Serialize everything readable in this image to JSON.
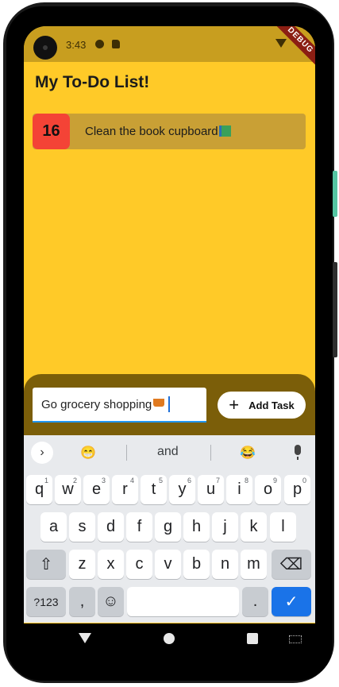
{
  "status_bar": {
    "time": "3:43",
    "debug_label": "DEBUG"
  },
  "app": {
    "title": "My To-Do List!"
  },
  "tasks": [
    {
      "number": "16",
      "text": "Clean the book cupboard"
    }
  ],
  "input": {
    "value": "Go grocery shopping ",
    "placeholder": ""
  },
  "add_button": {
    "label": "Add Task"
  },
  "keyboard": {
    "suggestions": [
      "😁",
      "and",
      "😂"
    ],
    "row1": [
      "q",
      "w",
      "e",
      "r",
      "t",
      "y",
      "u",
      "i",
      "o",
      "p"
    ],
    "row1_numbers": [
      "1",
      "2",
      "3",
      "4",
      "5",
      "6",
      "7",
      "8",
      "9",
      "0"
    ],
    "row2": [
      "a",
      "s",
      "d",
      "f",
      "g",
      "h",
      "j",
      "k",
      "l"
    ],
    "row3": [
      "z",
      "x",
      "c",
      "v",
      "b",
      "n",
      "m"
    ],
    "mode_key": "?123",
    "comma_key": ",",
    "period_key": "."
  },
  "icons": {
    "status": [
      "camera-icon",
      "notification-icon",
      "sd-card-icon",
      "wifi-icon",
      "battery-icon"
    ],
    "nav": [
      "back-icon",
      "home-icon",
      "recents-icon",
      "keyboard-icon"
    ]
  },
  "colors": {
    "app_background": "#ffca28",
    "task_card": "#c9a035",
    "task_badge": "#f44336",
    "bottom_panel": "#7b5e09",
    "enter_key": "#1a73e8"
  }
}
